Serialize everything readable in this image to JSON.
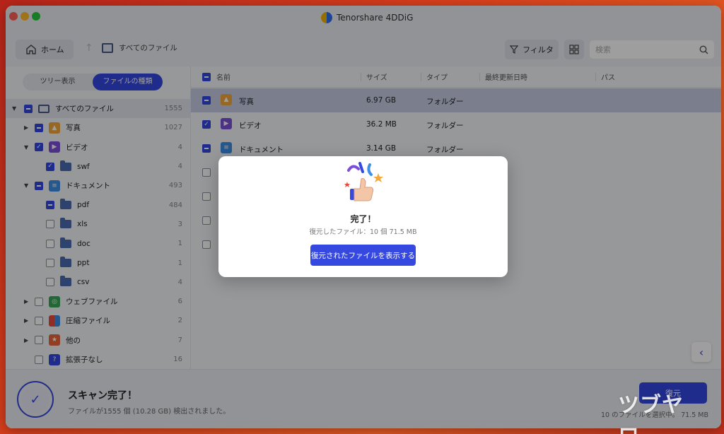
{
  "app": {
    "title": "Tenorshare 4DDiG"
  },
  "toolbar": {
    "home_label": "ホーム",
    "breadcrumb": "すべてのファイル",
    "filter_label": "フィルタ",
    "search_placeholder": "検索"
  },
  "sidebar": {
    "tabs": {
      "tree": "ツリー表示",
      "type": "ファイルの種類"
    },
    "tree": [
      {
        "label": "すべてのファイル",
        "count": "1555"
      },
      {
        "label": "写真",
        "count": "1027"
      },
      {
        "label": "ビデオ",
        "count": "4"
      },
      {
        "label": "swf",
        "count": "4"
      },
      {
        "label": "ドキュメント",
        "count": "493"
      },
      {
        "label": "pdf",
        "count": "484"
      },
      {
        "label": "xls",
        "count": "3"
      },
      {
        "label": "doc",
        "count": "1"
      },
      {
        "label": "ppt",
        "count": "1"
      },
      {
        "label": "csv",
        "count": "4"
      },
      {
        "label": "ウェブファイル",
        "count": "6"
      },
      {
        "label": "圧縮ファイル",
        "count": "2"
      },
      {
        "label": "他の",
        "count": "7"
      },
      {
        "label": "拡張子なし",
        "count": "16"
      }
    ]
  },
  "table": {
    "headers": {
      "name": "名前",
      "size": "サイズ",
      "type": "タイプ",
      "modified": "最終更新日時",
      "path": "パス"
    },
    "rows": [
      {
        "name": "写真",
        "size": "6.97 GB",
        "type": "フォルダー"
      },
      {
        "name": "ビデオ",
        "size": "36.2 MB",
        "type": "フォルダー"
      },
      {
        "name": "ドキュメント",
        "size": "3.14 GB",
        "type": "フォルダー"
      }
    ]
  },
  "bottom": {
    "scan_title": "スキャン完了！",
    "scan_sub": "ファイルが1555 個 (10.28 GB) 検出されました。",
    "recover_label": "復元",
    "selection_info": "10 のファイルを選択中。 71.5 MB"
  },
  "modal": {
    "title": "完了！",
    "subtitle": "復元したファイル：10 個 71.5 MB",
    "button": "復元されたファイルを表示する"
  },
  "watermark": "ツブヤロ。",
  "colors": {
    "accent": "#3548e0",
    "selection_row": "#c6cbe4"
  }
}
